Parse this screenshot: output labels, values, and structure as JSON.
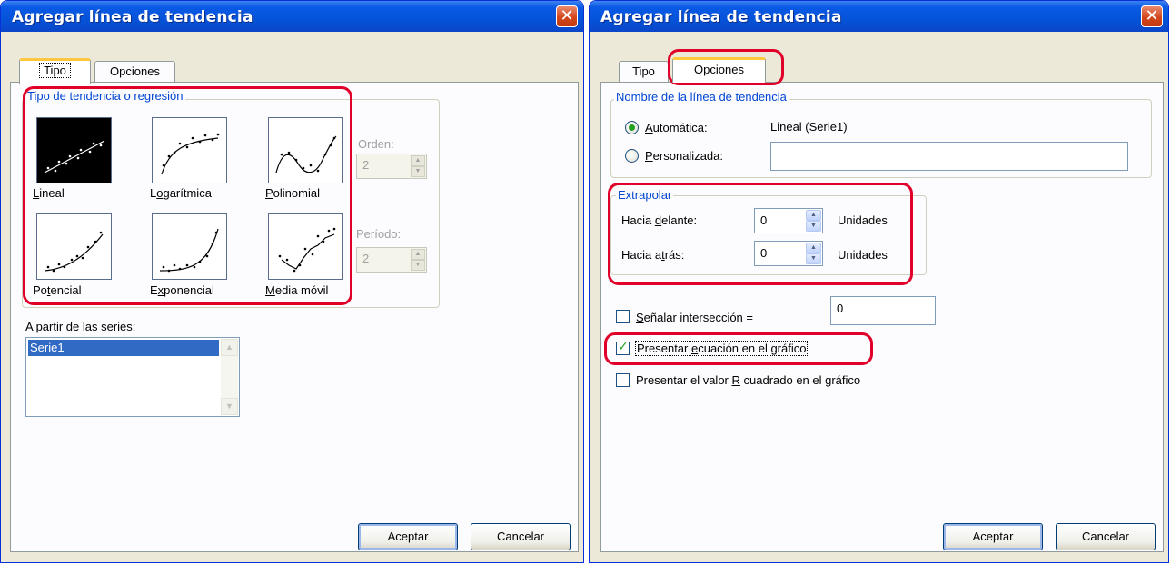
{
  "left": {
    "title": "Agregar línea de tendencia",
    "tabs": [
      {
        "label": "Tipo"
      },
      {
        "label": "Opciones"
      }
    ],
    "trend_group": {
      "legend": "Tipo de tendencia o regresión",
      "types": [
        {
          "label": "Lineal",
          "hotkey": "L",
          "rest": "ineal"
        },
        {
          "label": "Logarítmica",
          "hotkey": "o",
          "pre": "L",
          "rest": "garítmica"
        },
        {
          "label": "Polinomial",
          "hotkey": "P",
          "rest": "olinomial"
        },
        {
          "label": "Potencial",
          "hotkey": "t",
          "pre": "Po",
          "rest": "encial"
        },
        {
          "label": "Exponencial",
          "hotkey": "x",
          "pre": "E",
          "rest": "ponencial"
        },
        {
          "label": "Media móvil",
          "hotkey": "M",
          "rest": "edia móvil"
        }
      ],
      "order_label": "Orden:",
      "order_value": "2",
      "period_label": "Período:",
      "period_value": "2"
    },
    "series_label": {
      "hotkey": "A",
      "rest": " partir de las series:"
    },
    "series_items": [
      "Serie1"
    ],
    "buttons": {
      "ok": "Aceptar",
      "cancel": "Cancelar"
    }
  },
  "right": {
    "title": "Agregar línea de tendencia",
    "tabs": [
      {
        "label": "Tipo"
      },
      {
        "label": "Opciones"
      }
    ],
    "name_group": {
      "legend": "Nombre de la línea de tendencia",
      "auto": {
        "hotkey": "A",
        "rest": "utomática:"
      },
      "auto_value": "Lineal (Serie1)",
      "custom": {
        "hotkey": "P",
        "rest": "ersonalizada:"
      },
      "custom_value": ""
    },
    "extrapolate": {
      "legend": "Extrapolar",
      "forward": {
        "pre": "Hacia ",
        "hotkey": "d",
        "rest": "elante:"
      },
      "forward_value": "0",
      "backward": {
        "pre": "Hacia a",
        "hotkey": "t",
        "rest": "rás:"
      },
      "backward_value": "0",
      "units": "Unidades"
    },
    "intercept": {
      "hotkey": "S",
      "rest": "eñalar intersección =",
      "checked": false,
      "value": "0"
    },
    "show_equation": {
      "pre": "Presentar ",
      "hotkey": "e",
      "rest": "cuación en el gráfico",
      "checked": true
    },
    "show_r2": {
      "pre": "Presentar el valor ",
      "hotkey": "R",
      "rest": " cuadrado en el gráfico",
      "checked": false
    },
    "buttons": {
      "ok": "Aceptar",
      "cancel": "Cancelar"
    }
  },
  "colors": {
    "highlight": "#e0002a",
    "titlebar": "#0553d8",
    "group_legend": "#0046d5"
  }
}
